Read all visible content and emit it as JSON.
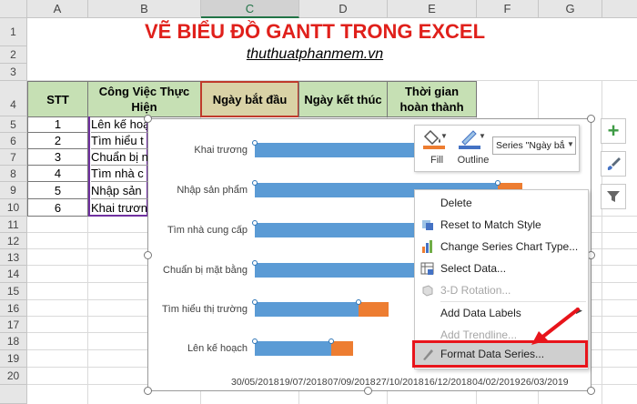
{
  "columns": [
    "A",
    "B",
    "C",
    "D",
    "E",
    "F",
    "G"
  ],
  "rows": [
    "1",
    "2",
    "3",
    "4",
    "5",
    "6",
    "7",
    "8",
    "9",
    "10",
    "11",
    "12",
    "13",
    "14",
    "15",
    "16",
    "17",
    "18",
    "19",
    "20"
  ],
  "title": "VẼ BIỂU ĐỒ GANTT TRONG EXCEL",
  "subtitle": "thuthuatphanmem.vn",
  "table": {
    "headers": [
      "STT",
      "Công Việc Thực Hiện",
      "Ngày bắt đầu",
      "Ngày kết thúc",
      "Thời gian hoàn thành"
    ],
    "stt": [
      "1",
      "2",
      "3",
      "4",
      "5",
      "6"
    ],
    "tasks": [
      "Lên kế hoạ",
      "Tìm hiểu t",
      "Chuẩn bị n",
      "Tìm nhà c",
      "Nhập sản",
      "Khai trươn"
    ]
  },
  "chart": {
    "categories": [
      "Khai trương",
      "Nhập sản phẩm",
      "Tìm nhà cung cấp",
      "Chuẩn bị mặt bằng",
      "Tìm hiểu thị trường",
      "Lên kế hoạch"
    ],
    "x_ticks": [
      "30/05/2018",
      "19/07/2018",
      "07/09/2018",
      "27/10/2018",
      "16/12/2018",
      "04/02/2019",
      "26/03/2019"
    ]
  },
  "chart_data": {
    "type": "bar",
    "categories": [
      "Khai trương",
      "Nhập sản phẩm",
      "Tìm nhà cung cấp",
      "Chuẩn bị mặt bằng",
      "Tìm hiểu thị trường",
      "Lên kế hoạch"
    ],
    "x_tick_labels": [
      "30/05/2018",
      "19/07/2018",
      "07/09/2018",
      "27/10/2018",
      "16/12/2018",
      "04/02/2019",
      "26/03/2019"
    ],
    "series": [
      {
        "values": [
          0.94,
          0.89,
          0.66,
          0.61,
          0.38,
          0.28
        ]
      },
      {
        "values": [
          0.0,
          0.09,
          0.0,
          0.0,
          0.11,
          0.08
        ]
      }
    ],
    "colors": [
      "#5b9bd5",
      "#ed7d31"
    ]
  },
  "mini_toolbar": {
    "fill_label": "Fill",
    "outline_label": "Outline",
    "series_select": "Series \"Ngày bắ"
  },
  "context_menu": {
    "items": [
      {
        "label": "Delete",
        "icon": "delete-icon",
        "disabled": false
      },
      {
        "label": "Reset to Match Style",
        "icon": "reset-icon",
        "disabled": false
      },
      {
        "label": "Change Series Chart Type...",
        "icon": "chart-type-icon",
        "disabled": false
      },
      {
        "label": "Select Data...",
        "icon": "select-data-icon",
        "disabled": false
      },
      {
        "label": "3-D Rotation...",
        "icon": "rotation-icon",
        "disabled": true
      },
      {
        "label": "Add Data Labels",
        "icon": "",
        "disabled": false
      },
      {
        "label": "Add Trendline...",
        "icon": "",
        "disabled": true
      },
      {
        "label": "Format Data Series...",
        "icon": "format-series-icon",
        "disabled": false
      }
    ]
  },
  "colors": {
    "title": "#e0201b",
    "header_fill": "#c6e0b4",
    "highlight": "#e8141b",
    "grid_header": "#e6e6e6"
  }
}
